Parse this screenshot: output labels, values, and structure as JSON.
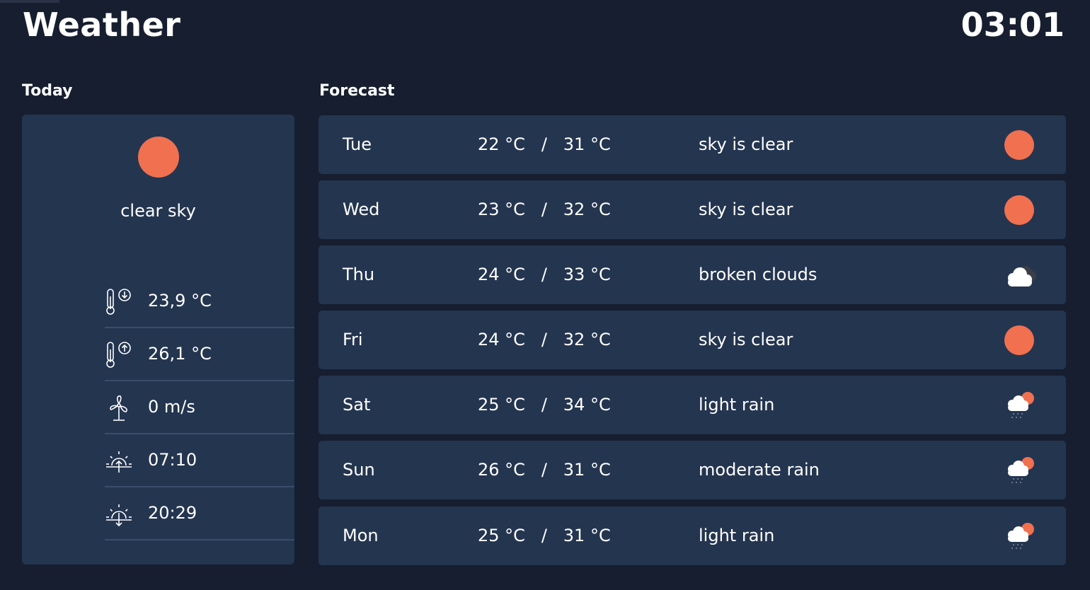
{
  "header": {
    "title": "Weather",
    "clock": "03:01"
  },
  "today": {
    "heading": "Today",
    "icon": "sun-icon",
    "description": "clear sky",
    "stats": [
      {
        "icon": "thermometer-min-icon",
        "value": "23,9 °C"
      },
      {
        "icon": "thermometer-max-icon",
        "value": "26,1 °C"
      },
      {
        "icon": "wind-turbine-icon",
        "value": "0 m/s"
      },
      {
        "icon": "sunrise-icon",
        "value": "07:10"
      },
      {
        "icon": "sunset-icon",
        "value": "20:29"
      }
    ]
  },
  "forecast": {
    "heading": "Forecast",
    "days": [
      {
        "day": "Tue",
        "temps": "22 °C   /   31 °C",
        "description": "sky is clear",
        "icon": "sun-icon"
      },
      {
        "day": "Wed",
        "temps": "23 °C   /   32 °C",
        "description": "sky is clear",
        "icon": "sun-icon"
      },
      {
        "day": "Thu",
        "temps": "24 °C   /   33 °C",
        "description": "broken clouds",
        "icon": "cloud-icon"
      },
      {
        "day": "Fri",
        "temps": "24 °C   /   32 °C",
        "description": "sky is clear",
        "icon": "sun-icon"
      },
      {
        "day": "Sat",
        "temps": "25 °C   /   34 °C",
        "description": "light rain",
        "icon": "sun-rain-cloud-icon"
      },
      {
        "day": "Sun",
        "temps": "26 °C   /   31 °C",
        "description": "moderate rain",
        "icon": "sun-rain-cloud-icon"
      },
      {
        "day": "Mon",
        "temps": "25 °C   /   31 °C",
        "description": "light rain",
        "icon": "sun-rain-cloud-icon"
      }
    ]
  },
  "colors": {
    "background": "#161e2f",
    "card": "#243550",
    "sun": "#f07050",
    "divider": "#3a4d6c"
  }
}
